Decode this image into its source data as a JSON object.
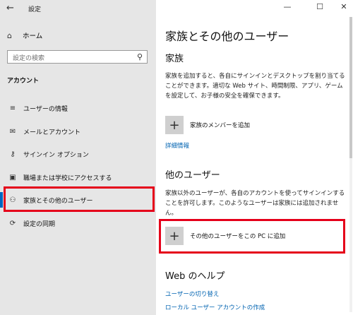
{
  "window": {
    "title": "設定",
    "back_icon": "←",
    "minimize_icon": "—",
    "maximize_icon": "☐",
    "close_icon": "✕"
  },
  "sidebar": {
    "home": {
      "label": "ホーム",
      "icon": "⌂"
    },
    "search": {
      "placeholder": "設定の検索",
      "icon": "⚲"
    },
    "section": "アカウント",
    "items": [
      {
        "label": "ユーザーの情報",
        "icon": "≡"
      },
      {
        "label": "メールとアカウント",
        "icon": "✉"
      },
      {
        "label": "サインイン オプション",
        "icon": "⚷"
      },
      {
        "label": "職場または学校にアクセスする",
        "icon": "▣"
      },
      {
        "label": "家族とその他のユーザー",
        "icon": "⚇"
      },
      {
        "label": "設定の同期",
        "icon": "⟳"
      }
    ]
  },
  "main": {
    "title": "家族とその他のユーザー",
    "family": {
      "heading": "家族",
      "desc": "家族を追加すると、各自にサインインとデスクトップを割り当てることができます。適切な Web サイト、時間制限、アプリ、ゲームを設定して、お子様の安全を確保できます。",
      "add_label": "家族のメンバーを追加",
      "link": "詳細情報"
    },
    "other": {
      "heading": "他のユーザー",
      "desc": "家族以外のユーザーが、各自のアカウントを使ってサインインすることを許可します。このようなユーザーは家族には追加されません。",
      "add_label": "その他のユーザーをこの PC に追加"
    },
    "help": {
      "heading": "Web のヘルプ",
      "links": [
        "ユーザーの切り替え",
        "ローカル ユーザー アカウントの作成"
      ]
    }
  },
  "colors": {
    "highlight": "#e5001a",
    "link": "#0063b1",
    "sidebar_bg": "#e6e6e6"
  }
}
